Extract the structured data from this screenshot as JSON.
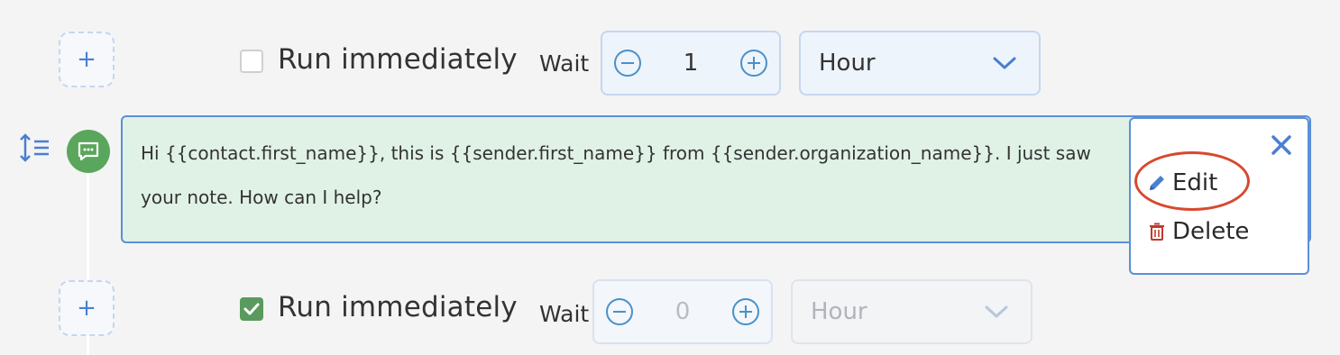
{
  "steps": [
    {
      "add_label": "+",
      "run_label": "Run immediately",
      "run_checked": false,
      "wait_label": "Wait",
      "wait_value": "1",
      "unit": "Hour",
      "disabled": false
    },
    {
      "add_label": "+",
      "run_label": "Run immediately",
      "run_checked": true,
      "wait_label": "Wait",
      "wait_value": "0",
      "unit": "Hour",
      "disabled": true
    }
  ],
  "message": {
    "text": "Hi {{contact.first_name}}, this is {{sender.first_name}} from {{sender.organization_name}}. I just saw your note. How can I help?",
    "icon": "chat-icon",
    "badge_color": "#5aa65c"
  },
  "menu": {
    "close_icon": "close-icon",
    "edit_label": "Edit",
    "delete_label": "Delete"
  },
  "colors": {
    "accent": "#5b8fd9",
    "message_bg": "#e0f2e6",
    "checked": "#5a9a5e",
    "delete_icon": "#c0392b",
    "highlight": "#d8482f"
  }
}
